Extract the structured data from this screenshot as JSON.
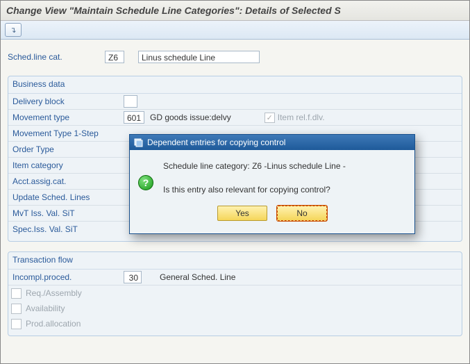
{
  "window": {
    "title": "Change View \"Maintain Schedule Line Categories\": Details of Selected S"
  },
  "toolbar": {
    "button_icon_label": "↴"
  },
  "header": {
    "sched_line_cat_label": "Sched.line cat.",
    "sched_line_cat_value": "Z6",
    "sched_line_cat_desc": "Linus schedule Line"
  },
  "business_data": {
    "title": "Business data",
    "rows": {
      "delivery_block": {
        "label": "Delivery block",
        "value": ""
      },
      "movement_type": {
        "label": "Movement type",
        "value": "601",
        "desc": "GD goods issue:delvy",
        "checkbox_label": "Item rel.f.dlv.",
        "checkbox_checked": true,
        "checkbox_disabled": true
      },
      "movement_type_1step": {
        "label": "Movement Type 1-Step"
      },
      "order_type": {
        "label": "Order Type"
      },
      "item_category": {
        "label": "Item category"
      },
      "acct_assig_cat": {
        "label": "Acct.assig.cat."
      },
      "update_sched_lines": {
        "label": "Update Sched. Lines"
      },
      "mvt_iss_val_sit": {
        "label": "MvT Iss. Val. SiT"
      },
      "spec_iss_val_sit": {
        "label": "Spec.Iss. Val. SiT"
      }
    }
  },
  "transaction_flow": {
    "title": "Transaction flow",
    "incompl_proced_label": "Incompl.proced.",
    "incompl_proced_value": "30",
    "incompl_proced_desc": "General Sched. Line",
    "req_assembly_label": "Req./Assembly",
    "availability_label": "Availability",
    "prod_allocation_label": "Prod.allocation"
  },
  "modal": {
    "title": "Dependent entries for copying control",
    "line1": "Schedule line category: Z6 -Linus schedule Line -",
    "line2": "Is this entry also relevant for copying control?",
    "yes_label": "Yes",
    "no_label": "No"
  }
}
